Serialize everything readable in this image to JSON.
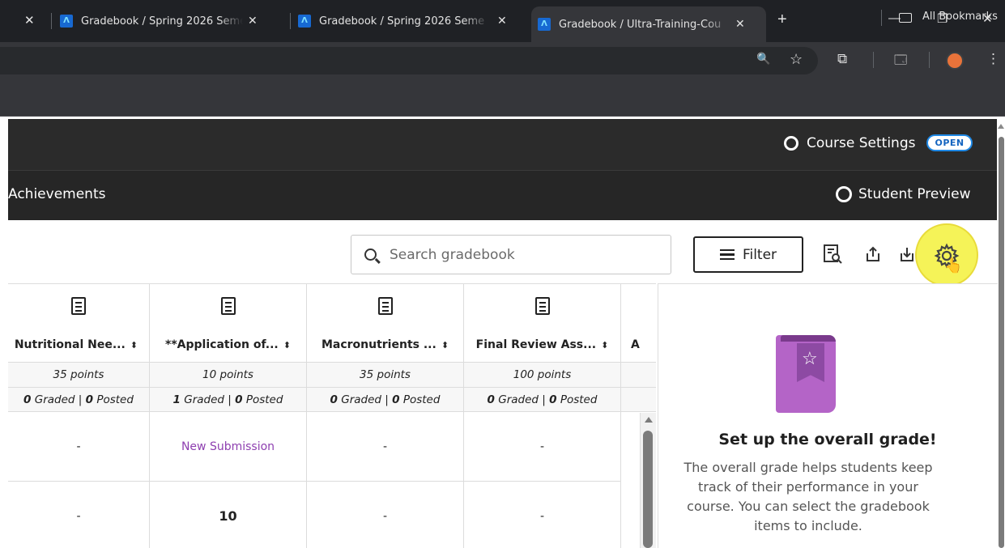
{
  "browser": {
    "tabs": [
      {
        "title": "Gradebook / Spring 2026 Seme",
        "active": false
      },
      {
        "title": "Gradebook / Spring 2026 Seme",
        "active": false
      },
      {
        "title": "Gradebook / Ultra-Training-Cou",
        "active": true
      }
    ],
    "favicon_glyph": "Λ",
    "close_glyph": "✕",
    "new_tab_glyph": "+",
    "minimize_glyph": "—",
    "restore_glyph": "❐",
    "window_close_glyph": "✕",
    "toolbar_glyphs": {
      "zoom": "🔍",
      "star": "☆",
      "extensions": "⧉",
      "reading": "🗔",
      "menu": "⋮"
    },
    "bookmarks_label": "All Bookmarks"
  },
  "app": {
    "course_settings_label": "Course Settings",
    "open_badge": "OPEN",
    "nav_achievements": "Achievements",
    "student_preview_label": "Student Preview"
  },
  "actions": {
    "search_placeholder": "Search gradebook",
    "filter_label": "Filter",
    "icons": [
      "report-icon",
      "upload-icon",
      "download-icon",
      "settings-gear-icon"
    ]
  },
  "table": {
    "columns": [
      {
        "title": "Nutritional Nee...",
        "points": "35 points",
        "graded": "0",
        "posted": "0",
        "rows": [
          "-",
          "-"
        ]
      },
      {
        "title": "**Application of...",
        "points": "10 points",
        "graded": "1",
        "posted": "0",
        "rows": [
          "New Submission",
          "10"
        ]
      },
      {
        "title": "Macronutrients ...",
        "points": "35 points",
        "graded": "0",
        "posted": "0",
        "rows": [
          "-",
          "-"
        ]
      },
      {
        "title": "Final Review Ass...",
        "points": "100 points",
        "graded": "0",
        "posted": "0",
        "rows": [
          "-",
          "-"
        ]
      }
    ],
    "graded_word": "Graded",
    "posted_word": "Posted",
    "sort_glyph": "⬍",
    "next_col_fragment": "A"
  },
  "panel": {
    "title": "Set up the overall grade!",
    "body": "The overall grade helps students keep track of their performance in your course. You can select the gradebook items to include."
  },
  "colors": {
    "link": "#8e3fb0",
    "badge": "#1565c0",
    "highlight": "#f5f24a",
    "book": "#b464c7"
  }
}
